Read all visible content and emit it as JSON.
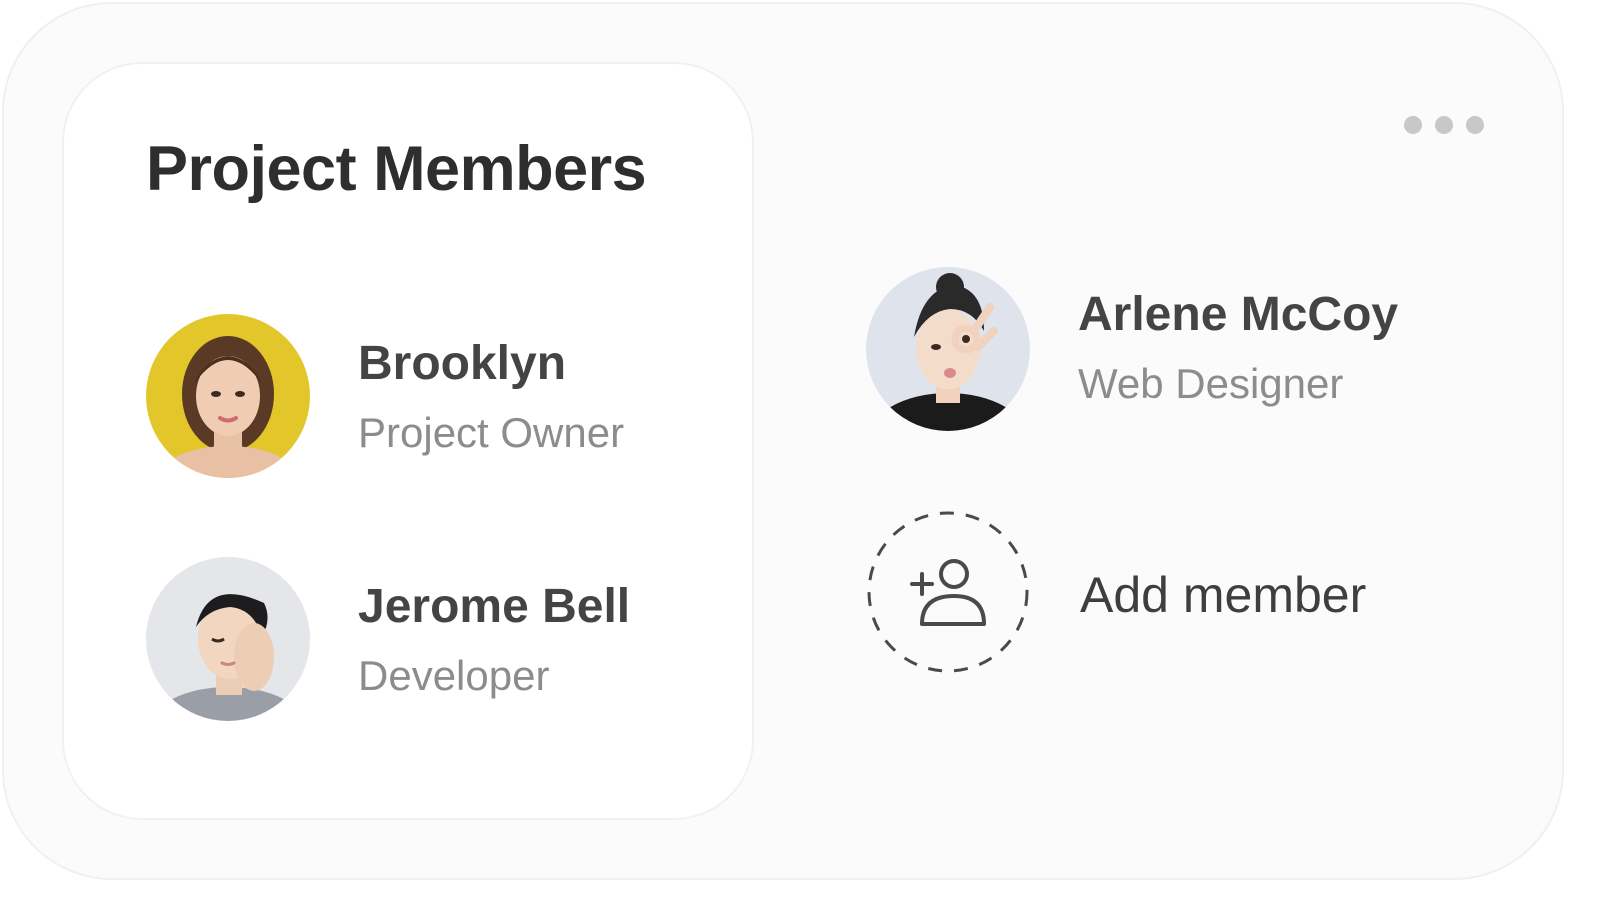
{
  "card": {
    "title": "Project Members",
    "more_icon": "more-horizontal-icon"
  },
  "members": [
    {
      "name": "Brooklyn",
      "role": "Project Owner",
      "avatar_bg": "#e2c62a"
    },
    {
      "name": "Jerome Bell",
      "role": "Developer",
      "avatar_bg": "#e4e6ea"
    },
    {
      "name": "Arlene McCoy",
      "role": "Web Designer",
      "avatar_bg": "#dfe4ec"
    }
  ],
  "add_member": {
    "label": "Add member",
    "icon": "user-plus-icon"
  },
  "colors": {
    "title": "#2e2e2e",
    "name": "#444444",
    "role": "#8c8c8c",
    "outer_bg": "#fbfbfb",
    "inner_bg": "#ffffff"
  }
}
